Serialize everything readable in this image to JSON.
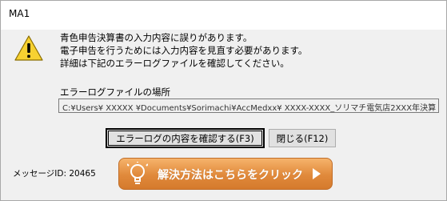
{
  "window": {
    "title": "MA1"
  },
  "message": {
    "line1": "青色申告決算書の入力内容に誤りがあります。",
    "line2": "電子申告を行うためには入力内容を見直す必要があります。",
    "line3": "詳細は下記のエラーログファイルを確認してください。"
  },
  "log_location": {
    "label": "エラーログファイルの場所",
    "path": "C:¥Users¥ XXXXX ¥Documents¥Sorimachi¥AccMedxx¥ XXXX-XXXX_ソリマチ電気店2XXX年決算"
  },
  "buttons": {
    "confirm_label": "エラーログの内容を確認する(F3)",
    "close_label": "閉じる(F12)"
  },
  "footer": {
    "message_id": "メッセージID: 20465",
    "solution_label": "解決方法はこちらをクリック"
  },
  "icons": {
    "warning": "warning-icon",
    "bulb": "lightbulb-icon",
    "arrow": "arrow-right-icon"
  },
  "colors": {
    "solution_button": "#e0893b",
    "warning_yellow": "#f7d131"
  }
}
